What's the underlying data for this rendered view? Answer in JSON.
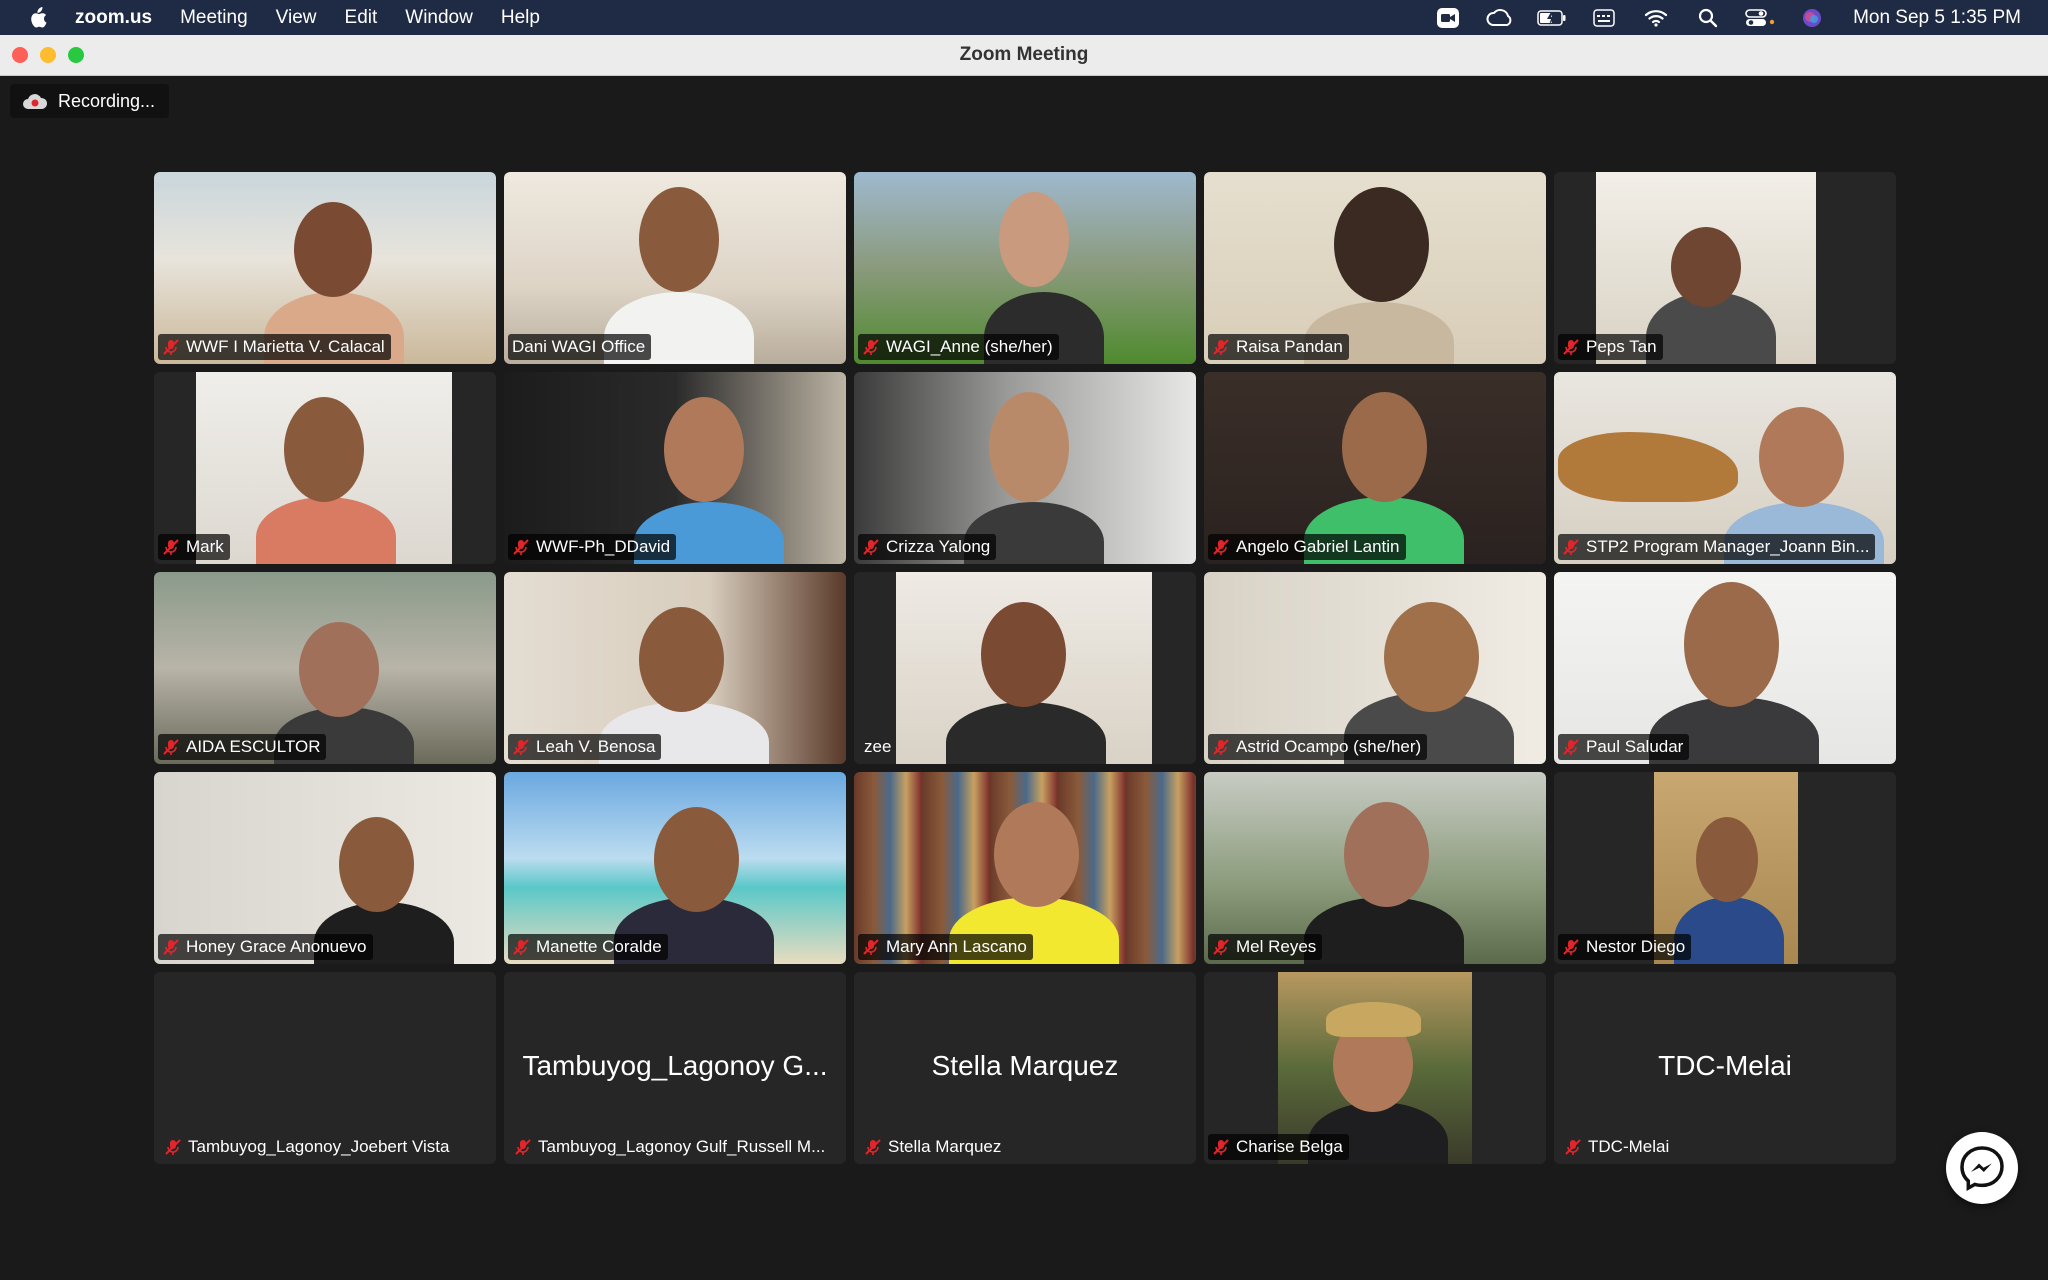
{
  "menubar": {
    "app_name": "zoom.us",
    "menus": [
      "Meeting",
      "View",
      "Edit",
      "Window",
      "Help"
    ],
    "clock": "Mon Sep 5  1:35 PM"
  },
  "window": {
    "title": "Zoom Meeting"
  },
  "recording": {
    "label": "Recording..."
  },
  "participants": [
    {
      "name": "WWF I Marietta V. Calacal",
      "muted": true
    },
    {
      "name": "Dani WAGI Office",
      "muted": false
    },
    {
      "name": "WAGI_Anne (she/her)",
      "muted": true
    },
    {
      "name": "Raisa Pandan",
      "muted": true
    },
    {
      "name": "Peps Tan",
      "muted": true
    },
    {
      "name": "Mark",
      "muted": true
    },
    {
      "name": "WWF-Ph_DDavid",
      "muted": true
    },
    {
      "name": "Crizza Yalong",
      "muted": true
    },
    {
      "name": "Angelo Gabriel Lantin",
      "muted": true
    },
    {
      "name": "STP2 Program Manager_Joann Bin...",
      "muted": true,
      "active_speaker": true
    },
    {
      "name": "AIDA ESCULTOR",
      "muted": true
    },
    {
      "name": "Leah V. Benosa",
      "muted": true
    },
    {
      "name": "zee",
      "muted": false
    },
    {
      "name": "Astrid Ocampo (she/her)",
      "muted": true
    },
    {
      "name": "Paul Saludar",
      "muted": true
    },
    {
      "name": "Honey Grace Anonuevo",
      "muted": true
    },
    {
      "name": "Manette Coralde",
      "muted": true
    },
    {
      "name": "Mary  Ann Lascano",
      "muted": true
    },
    {
      "name": "Mel Reyes",
      "muted": true
    },
    {
      "name": "Nestor Diego",
      "muted": true
    },
    {
      "name": "Tambuyog_Lagonoy_Joebert Vista",
      "muted": true,
      "video_off": true,
      "display_name": ""
    },
    {
      "name": "Tambuyog_Lagonoy Gulf_Russell M...",
      "muted": true,
      "video_off": true,
      "display_name": "Tambuyog_Lagonoy G..."
    },
    {
      "name": "Stella Marquez",
      "muted": true,
      "video_off": true,
      "display_name": "Stella Marquez"
    },
    {
      "name": "Charise Belga",
      "muted": true
    },
    {
      "name": "TDC-Melai",
      "muted": true,
      "video_off": true,
      "display_name": "TDC-Melai"
    }
  ],
  "colors": {
    "menubar_bg": "#1f2a44",
    "meeting_bg": "#1a1a1a",
    "tile_off_bg": "#262626",
    "active_speaker_border": "#3ad03a",
    "muted_icon": "#e0262b"
  }
}
